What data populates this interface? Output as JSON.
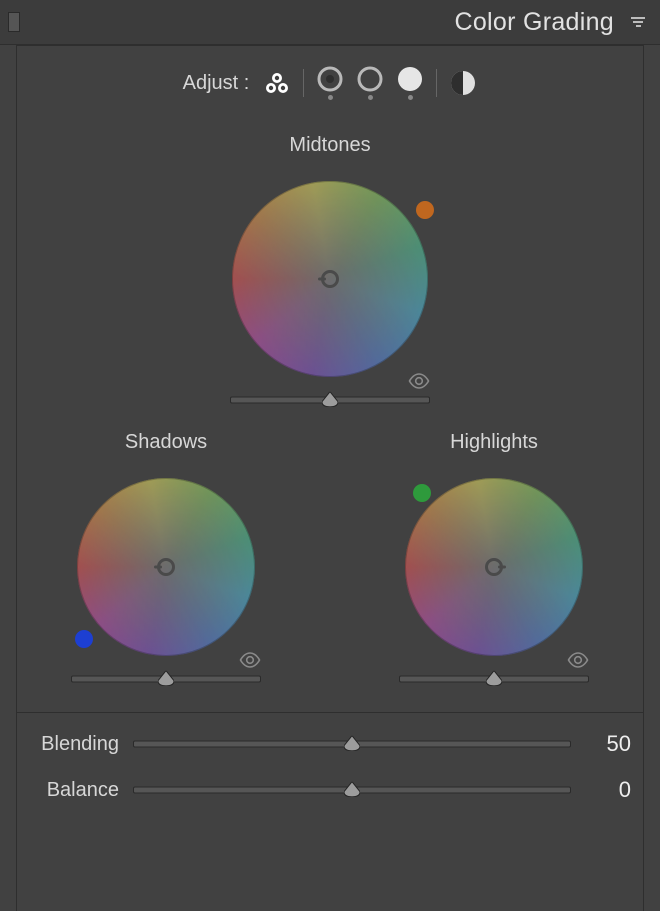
{
  "panel": {
    "title": "Color Grading",
    "adjust_label": "Adjust :"
  },
  "modes": {
    "three_way": "three-way",
    "shadows": "shadows",
    "midtones": "midtones",
    "highlights": "highlights",
    "global": "global"
  },
  "wheels": {
    "midtones": {
      "title": "Midtones",
      "luminance_pct": 50,
      "selected_hue": 25,
      "edge_color": "#c0671f",
      "edge_angle_deg": -25
    },
    "shadows": {
      "title": "Shadows",
      "luminance_pct": 50,
      "selected_hue": 225,
      "edge_color": "#1d3fd2",
      "edge_angle_deg": 130
    },
    "highlights": {
      "title": "Highlights",
      "luminance_pct": 50,
      "selected_hue": 130,
      "edge_color": "#2e9a3c",
      "edge_angle_deg": -130
    }
  },
  "sliders": {
    "blending": {
      "label": "Blending",
      "value": 50,
      "min": 0,
      "max": 100
    },
    "balance": {
      "label": "Balance",
      "value": 0,
      "min": -100,
      "max": 100
    }
  }
}
